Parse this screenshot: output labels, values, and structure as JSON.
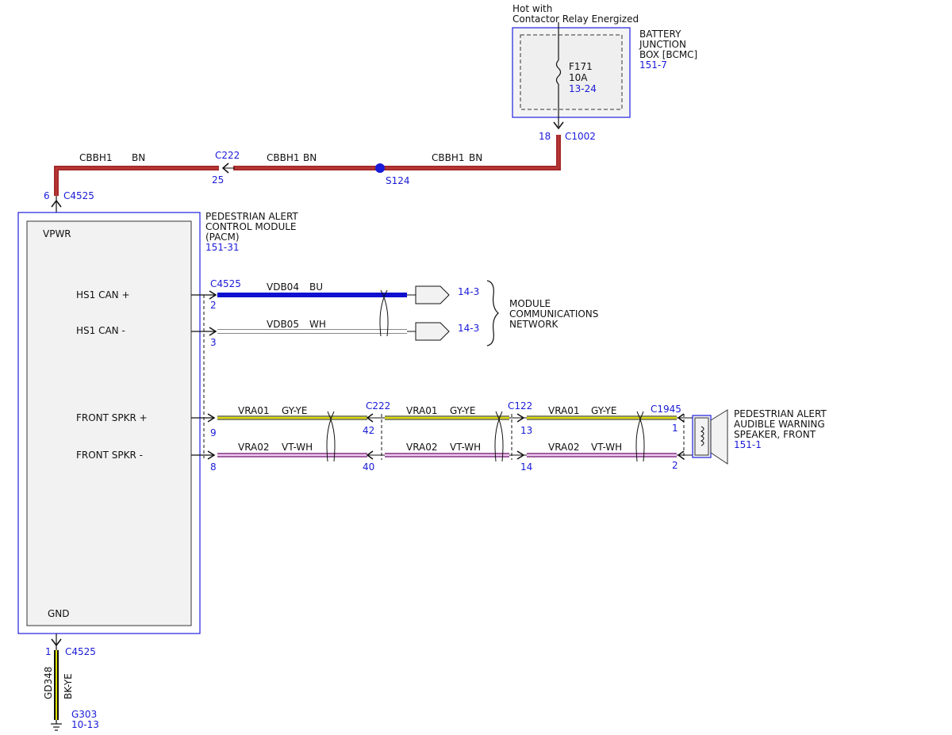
{
  "battery_junction_box": {
    "title_lines": [
      "BATTERY",
      "JUNCTION",
      "BOX [BCMC]"
    ],
    "ref": "151-7",
    "feed_note": [
      "Hot with",
      "Contactor Relay Energized"
    ],
    "fuse": {
      "id": "F171",
      "rating": "10A",
      "ref": "13-24"
    },
    "output_pin": "18",
    "output_connector": "C1002"
  },
  "power_feed": {
    "circuit": "CBBH1",
    "color": "BN",
    "wire_hex": "#a52a2a",
    "inline_connector": "C222",
    "inline_pin": "25",
    "splice": "S124",
    "pacm_pin": "6",
    "pacm_connector": "C4525"
  },
  "pacm": {
    "title_lines": [
      "PEDESTRIAN ALERT",
      "CONTROL MODULE",
      "(PACM)"
    ],
    "ref": "151-31",
    "pins": {
      "vpwr": "VPWR",
      "can_plus": "HS1 CAN +",
      "can_minus": "HS1 CAN -",
      "spkr_plus": "FRONT SPKR +",
      "spkr_minus": "FRONT SPKR -",
      "gnd": "GND"
    }
  },
  "can_bus": {
    "connector": "C4525",
    "plus": {
      "pin": "2",
      "circuit": "VDB04",
      "color": "BU",
      "wire_hex": "#1010d0",
      "ref": "14-3"
    },
    "minus": {
      "pin": "3",
      "circuit": "VDB05",
      "color": "WH",
      "wire_hex": "#e8e8e8",
      "ref": "14-3"
    },
    "network_label": [
      "MODULE",
      "COMMUNICATIONS",
      "NETWORK"
    ]
  },
  "speaker_circuit": {
    "plus": {
      "circuit": "VRA01",
      "color": "GY-YE",
      "wire_hex": "#8a8a6a",
      "stripe_hex": "#d8d800",
      "pins": [
        "9",
        "42",
        "13",
        "1"
      ]
    },
    "minus": {
      "circuit": "VRA02",
      "color": "VT-WH",
      "wire_hex": "#c878c8",
      "stripe_hex": "#ffffff",
      "pins": [
        "8",
        "40",
        "14",
        "2"
      ]
    },
    "connectors": [
      "C222",
      "C122",
      "C1945"
    ]
  },
  "speaker": {
    "title_lines": [
      "PEDESTRIAN ALERT",
      "AUDIBLE WARNING",
      "SPEAKER, FRONT"
    ],
    "ref": "151-1"
  },
  "ground": {
    "pin": "1",
    "connector": "C4525",
    "circuit": "GD348",
    "color": "BK-YE",
    "wire_hex": "#111111",
    "stripe_hex": "#e0e000",
    "ground_point": "G303",
    "ref": "10-13"
  },
  "colors": {
    "component_outline": "#2020e0",
    "reference_text": "#1a1ad8",
    "module_fill": "#f2f2f2"
  }
}
